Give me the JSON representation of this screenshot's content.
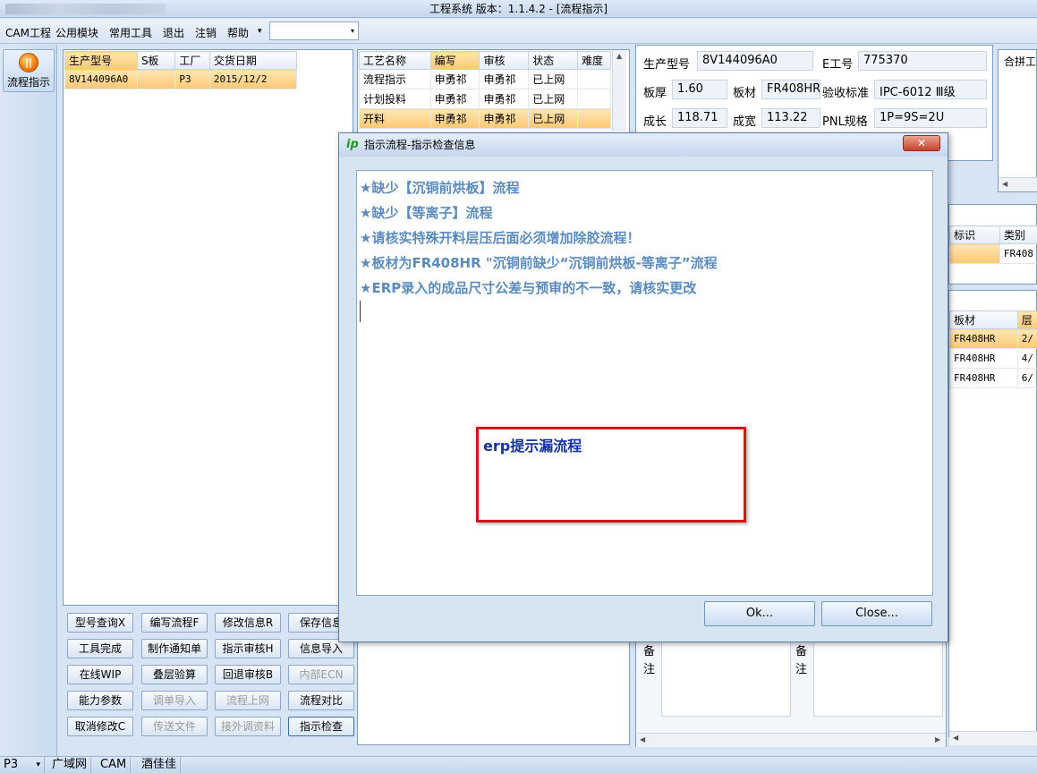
{
  "window": {
    "title": "工程系统   版本：1.1.4.2 - [流程指示]"
  },
  "menu": {
    "items": [
      "CAM工程",
      "公用模块",
      "常用工具",
      "退出",
      "注销",
      "帮助"
    ],
    "dropdown_arrow": "▾"
  },
  "leftnav": {
    "flow_button_label": "流程指示"
  },
  "product_grid": {
    "headers": [
      "生产型号",
      "S板",
      "工厂",
      "交货日期"
    ],
    "rows": [
      {
        "model": "8V144096A0",
        "s": "",
        "factory": "P3",
        "date": "2015/12/2"
      }
    ]
  },
  "process_grid": {
    "headers": [
      "工艺名称",
      "编写",
      "审核",
      "状态",
      "难度"
    ],
    "rows": [
      {
        "name": "流程指示",
        "author": "申勇祁",
        "reviewer": "申勇祁",
        "status": "已上网",
        "difficulty": ""
      },
      {
        "name": "计划投料",
        "author": "申勇祁",
        "reviewer": "申勇祁",
        "status": "已上网",
        "difficulty": ""
      },
      {
        "name": "开料",
        "author": "申勇祁",
        "reviewer": "申勇祁",
        "status": "已上网",
        "difficulty": ""
      }
    ]
  },
  "buttons": [
    [
      "型号查询X",
      "编写流程F",
      "修改信息R",
      "保存信息"
    ],
    [
      "工具完成",
      "制作通知单",
      "指示审核H",
      "信息导入"
    ],
    [
      "在线WIP",
      "叠层验算",
      "回退审核B",
      "内部ECN"
    ],
    [
      "能力参数",
      "调单导入",
      "流程上网",
      "流程对比"
    ],
    [
      "取消修改C",
      "传送文件",
      "接外调资料",
      "指示检查"
    ]
  ],
  "info": {
    "model_label": "生产型号",
    "model_value": "8V144096A0",
    "e_label": "E工号",
    "e_value": "775370",
    "thickness_label": "板厚",
    "thickness_value": "1.60",
    "material_label": "板材",
    "material_value": "FR408HR",
    "standard_label": "验收标准",
    "standard_value": "IPC-6012 Ⅲ级",
    "length_label": "成长",
    "length_value": "118.71",
    "width_label": "成宽",
    "width_value": "113.22",
    "pnl_label": "PNL规格",
    "pnl_value": "1P=9S=2U",
    "panel_combine_label": "合拼工"
  },
  "right_grid_1": {
    "headers": [
      "标识",
      "类别"
    ],
    "rows": [
      [
        "",
        "FR408"
      ]
    ]
  },
  "right_grid_2": {
    "headers": [
      "板材",
      "层"
    ],
    "rows": [
      [
        "FR408HR",
        "2/"
      ],
      [
        "FR408HR",
        "4/"
      ],
      [
        "FR408HR",
        "6/"
      ]
    ]
  },
  "remarks": {
    "label_left": "备注",
    "label_right": "备注"
  },
  "dialog": {
    "title": "指示流程-指示检查信息",
    "logo": "ip",
    "close": "✕",
    "messages": [
      "★缺少【沉铜前烘板】流程",
      "★缺少【等离子】流程",
      "★请核实特殊开料层压后面必须增加除胶流程！",
      "★板材为FR408HR  \"沉铜前缺少“沉铜前烘板-等离子”流程",
      "★ERP录入的成品尺寸公差与预审的不一致，请核实更改"
    ],
    "annotation": "erp提示漏流程",
    "ok_label": "Ok...",
    "close_label": "Close..."
  },
  "statusbar": {
    "factory": "P3",
    "tabs": [
      "广域网",
      "CAM",
      "酒佳佳"
    ]
  }
}
